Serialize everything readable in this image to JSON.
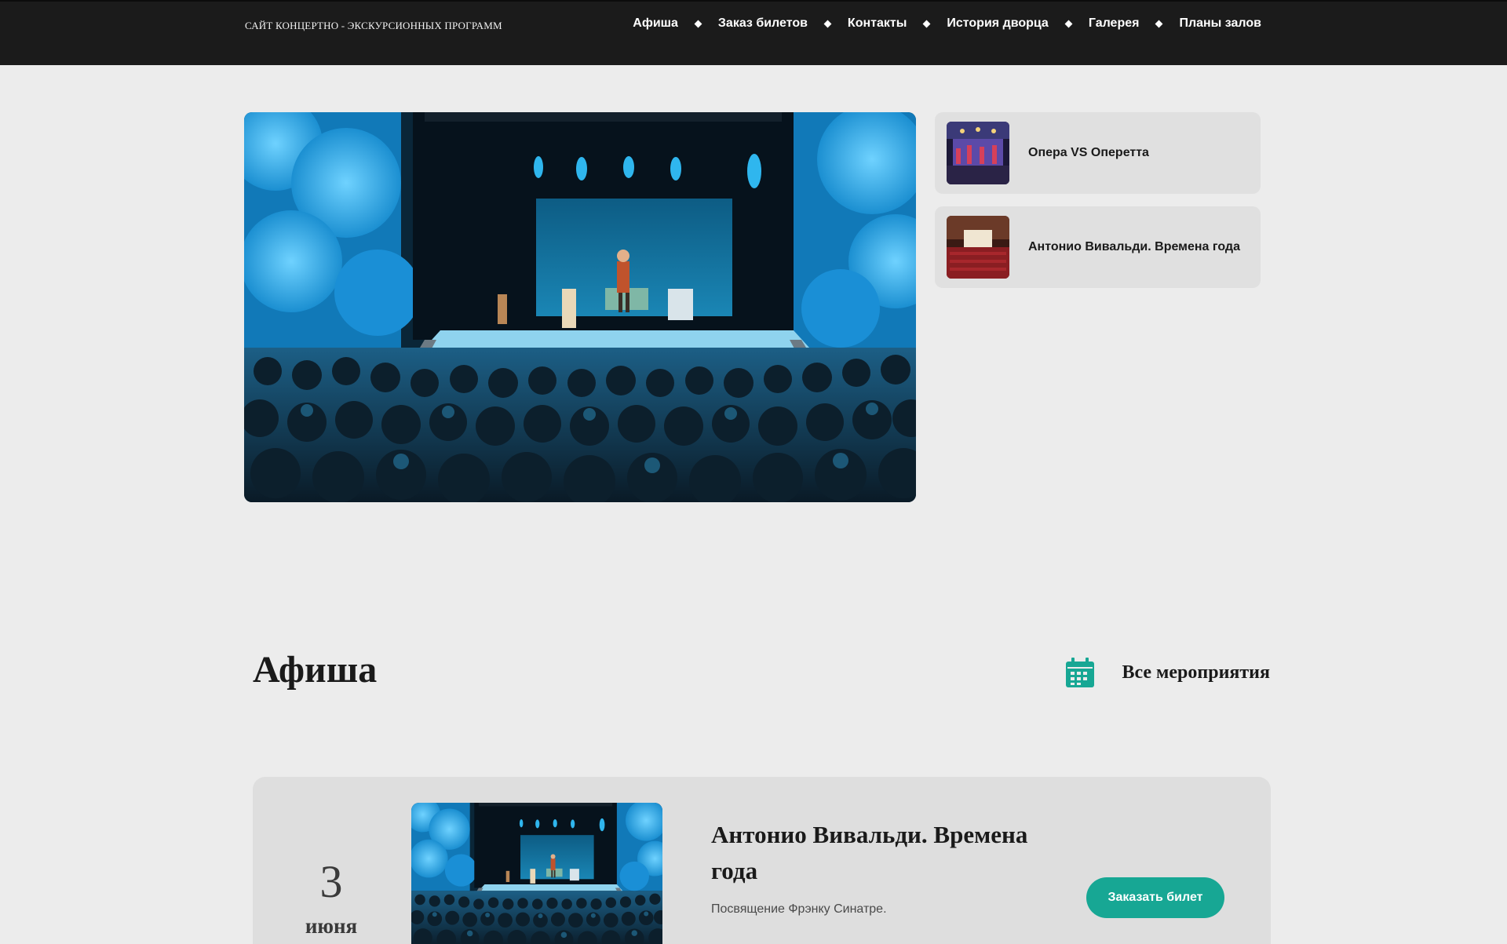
{
  "header": {
    "site_title": "САЙТ КОНЦЕРТНО - ЭКСКУРСИОННЫХ ПРОГРАММ",
    "nav": [
      {
        "label": "Афиша"
      },
      {
        "label": "Заказ билетов"
      },
      {
        "label": "Контакты"
      },
      {
        "label": "История дворца"
      },
      {
        "label": "Галерея"
      },
      {
        "label": "Планы залов"
      }
    ]
  },
  "hero": {
    "image_icon": "theater-stage-photo",
    "side_items": [
      {
        "label": "Опера VS Оперетта",
        "thumb_icon": "opera-stage-thumbnail"
      },
      {
        "label": "Антонио Вивальди. Времена года",
        "thumb_icon": "concert-hall-thumbnail"
      }
    ]
  },
  "afisha": {
    "title": "Афиша",
    "all_events_label": "Все мероприятия",
    "all_events_icon": "calendar-icon",
    "accent_color": "#17a794",
    "events": [
      {
        "day": "3",
        "month": "июня",
        "title": "Антонио Вивальди. Времена года",
        "description": "Посвящение Фрэнку Синатре.",
        "button_label": "Заказать билет",
        "thumb_icon": "theater-stage-photo"
      }
    ]
  }
}
